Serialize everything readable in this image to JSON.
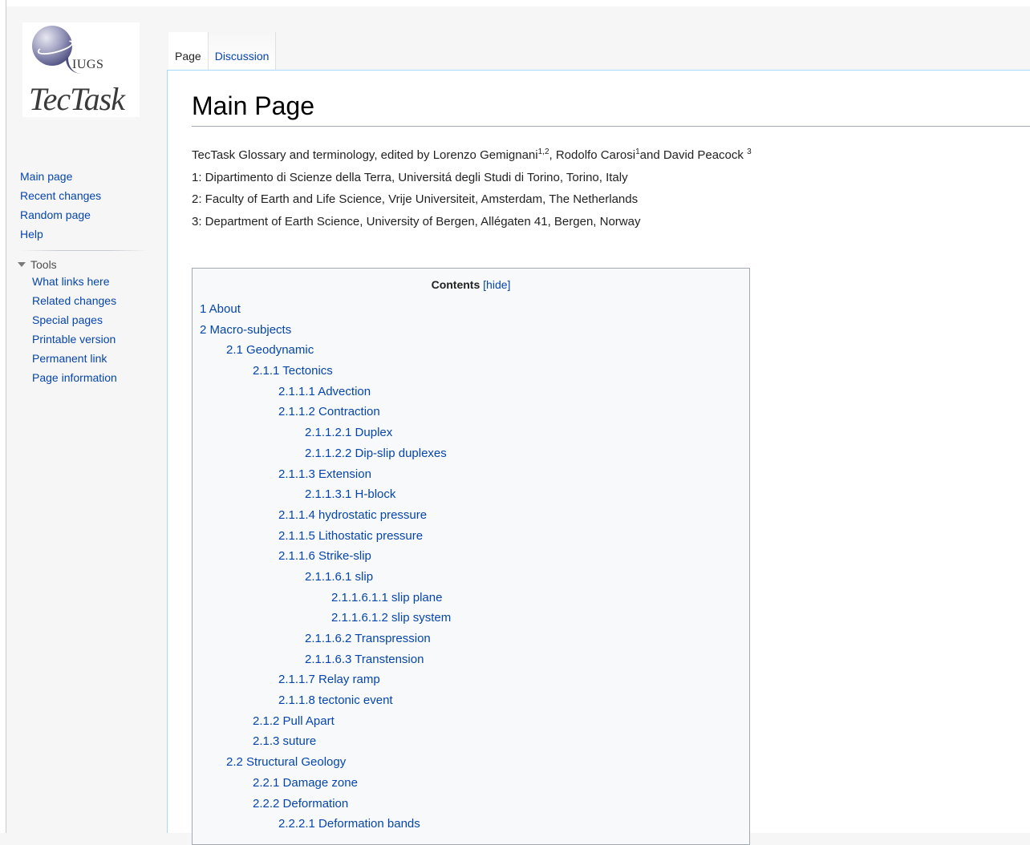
{
  "logo": {
    "iugs": "IUGS",
    "name": "TecTask"
  },
  "sidebar": {
    "nav": [
      "Main page",
      "Recent changes",
      "Random page",
      "Help"
    ],
    "tools_label": "Tools",
    "tools": [
      "What links here",
      "Related changes",
      "Special pages",
      "Printable version",
      "Permanent link",
      "Page information"
    ]
  },
  "tabs": {
    "page": "Page",
    "discussion": "Discussion"
  },
  "page": {
    "title": "Main Page",
    "intro": {
      "line1_a": "TecTask Glossary and terminology, edited by Lorenzo Gemignani",
      "line1_sup1": "1,2",
      "line1_b": ", Rodolfo Carosi",
      "line1_sup2": "1",
      "line1_c": "and David Peacock ",
      "line1_sup3": "3",
      "line2": "1: Dipartimento di Scienze della Terra, Universitá degli Studi di Torino, Torino, Italy",
      "line3": "2: Faculty of Earth and Life Science, Vrije Universiteit, Amsterdam, The Netherlands",
      "line4": "3: Department of Earth Science, University of Bergen, Allégaten 41, Bergen, Norway"
    }
  },
  "toc": {
    "title": "Contents",
    "hide": "[hide]",
    "items": [
      {
        "text": "1 About",
        "level": 1
      },
      {
        "text": "2 Macro-subjects",
        "level": 1
      },
      {
        "text": "2.1 Geodynamic",
        "level": 2
      },
      {
        "text": "2.1.1 Tectonics",
        "level": 3
      },
      {
        "text": "2.1.1.1 Advection",
        "level": 4
      },
      {
        "text": "2.1.1.2 Contraction",
        "level": 4
      },
      {
        "text": "2.1.1.2.1 Duplex",
        "level": 5
      },
      {
        "text": "2.1.1.2.2 Dip-slip duplexes",
        "level": 5
      },
      {
        "text": "2.1.1.3 Extension",
        "level": 4
      },
      {
        "text": "2.1.1.3.1 H-block",
        "level": 5
      },
      {
        "text": "2.1.1.4 hydrostatic pressure",
        "level": 4
      },
      {
        "text": "2.1.1.5 Lithostatic pressure",
        "level": 4
      },
      {
        "text": "2.1.1.6 Strike-slip",
        "level": 4
      },
      {
        "text": "2.1.1.6.1 slip",
        "level": 5
      },
      {
        "text": "2.1.1.6.1.1 slip plane",
        "level": 6
      },
      {
        "text": "2.1.1.6.1.2 slip system",
        "level": 6
      },
      {
        "text": "2.1.1.6.2 Transpression",
        "level": 5
      },
      {
        "text": "2.1.1.6.3 Transtension",
        "level": 5
      },
      {
        "text": "2.1.1.7 Relay ramp",
        "level": 4
      },
      {
        "text": "2.1.1.8 tectonic event",
        "level": 4
      },
      {
        "text": "2.1.2 Pull Apart",
        "level": 3
      },
      {
        "text": "2.1.3 suture",
        "level": 3
      },
      {
        "text": "2.2 Structural Geology",
        "level": 2
      },
      {
        "text": "2.2.1 Damage zone",
        "level": 3
      },
      {
        "text": "2.2.2 Deformation",
        "level": 3
      },
      {
        "text": "2.2.2.1 Deformation bands",
        "level": 4
      }
    ]
  }
}
